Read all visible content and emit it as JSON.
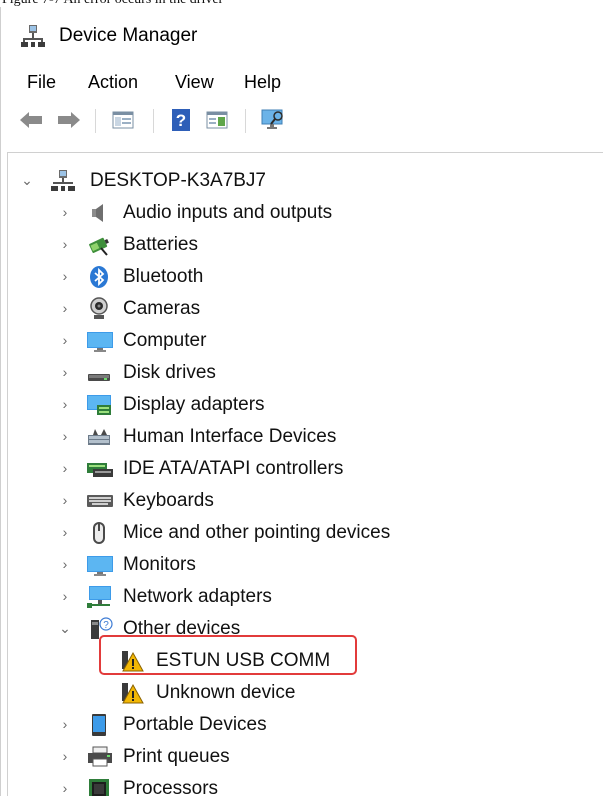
{
  "caption": "Figure 7-7 An error occurs in the driver",
  "window": {
    "title": "Device Manager"
  },
  "menu": {
    "items": [
      {
        "label": "File"
      },
      {
        "label": "Action"
      },
      {
        "label": "View"
      },
      {
        "label": "Help"
      }
    ]
  },
  "toolbar": {
    "buttons": [
      "back-arrow-icon",
      "forward-arrow-icon",
      "show-hide-console-tree-icon",
      "help-icon",
      "properties-icon",
      "scan-hardware-icon"
    ]
  },
  "tree": {
    "root": {
      "label": "DESKTOP-K3A7BJ7",
      "expanded": true
    },
    "categories": [
      {
        "label": "Audio inputs and outputs",
        "icon": "speaker-icon"
      },
      {
        "label": "Batteries",
        "icon": "battery-icon"
      },
      {
        "label": "Bluetooth",
        "icon": "bluetooth-icon"
      },
      {
        "label": "Cameras",
        "icon": "camera-icon"
      },
      {
        "label": "Computer",
        "icon": "monitor-icon"
      },
      {
        "label": "Disk drives",
        "icon": "disk-drive-icon"
      },
      {
        "label": "Display adapters",
        "icon": "display-adapter-icon"
      },
      {
        "label": "Human Interface Devices",
        "icon": "hid-icon"
      },
      {
        "label": "IDE ATA/ATAPI controllers",
        "icon": "ide-controller-icon"
      },
      {
        "label": "Keyboards",
        "icon": "keyboard-icon"
      },
      {
        "label": "Mice and other pointing devices",
        "icon": "mouse-icon"
      },
      {
        "label": "Monitors",
        "icon": "monitor-icon"
      },
      {
        "label": "Network adapters",
        "icon": "network-adapter-icon"
      },
      {
        "label": "Other devices",
        "icon": "unknown-device-icon",
        "expanded": true,
        "children": [
          {
            "label": "ESTUN USB COMM",
            "icon": "warning-device-icon",
            "highlighted": true
          },
          {
            "label": "Unknown device",
            "icon": "warning-device-icon"
          }
        ]
      },
      {
        "label": "Portable Devices",
        "icon": "portable-device-icon"
      },
      {
        "label": "Print queues",
        "icon": "printer-icon"
      },
      {
        "label": "Processors",
        "icon": "processor-icon"
      }
    ]
  },
  "colors": {
    "highlight_border": "#e23b3b",
    "warning": "#f2b705",
    "chevron": "#6a6a6a"
  }
}
